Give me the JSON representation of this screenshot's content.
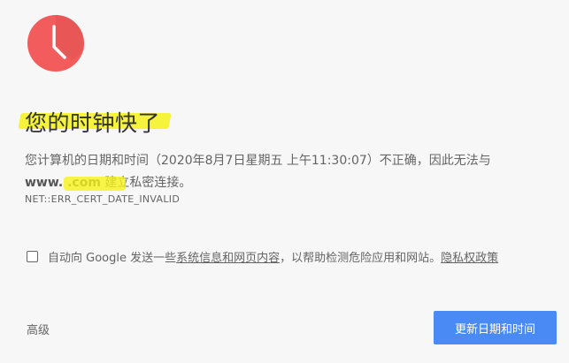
{
  "header": {
    "title": "您的时钟快了",
    "icon_name": "clock-icon",
    "accent_color": "#f25c5c",
    "highlight_color": "#f6f21a"
  },
  "body": {
    "description_line1": "您计算机的日期和时间（2020年8月7日星期五 上午11:30:07）不正确，因此无法与",
    "host_text": "www.           .com",
    "description_line2_suffix": " 建立私密连接。",
    "error_code": "NET::ERR_CERT_DATE_INVALID"
  },
  "report": {
    "checkbox_checked": false,
    "text_before_link": "自动向 Google 发送一些",
    "system_info_link": "系统信息和网页内容",
    "text_after_link": "，以帮助检测危险应用和网站。",
    "privacy_link": "隐私权政策"
  },
  "footer": {
    "advanced_label": "高级",
    "primary_button_label": "更新日期和时间",
    "primary_button_color": "#4a8af4"
  }
}
